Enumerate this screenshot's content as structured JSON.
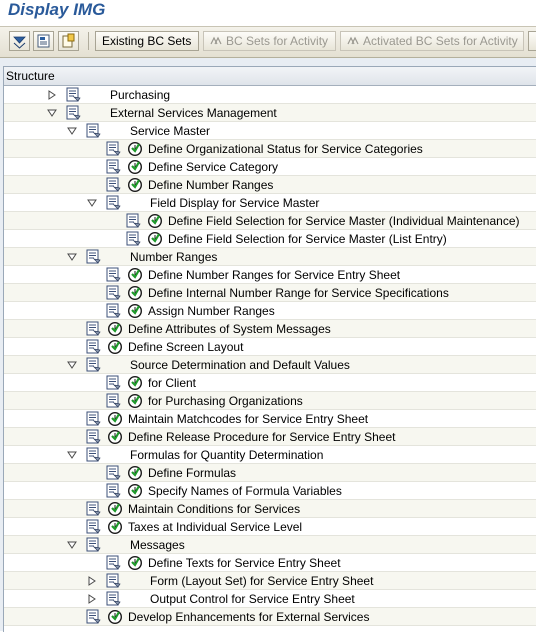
{
  "window": {
    "title": "Display IMG"
  },
  "toolbar": {
    "existing_bc_sets": "Existing BC Sets",
    "bc_sets_for_activity": "BC Sets for Activity",
    "activated_bc_sets_for_activity": "Activated BC Sets for Activity"
  },
  "tree": {
    "column_header": "Structure",
    "rows": [
      {
        "label": "Purchasing",
        "level": 0,
        "toggle": "collapsed",
        "activity": false
      },
      {
        "label": "External Services Management",
        "level": 0,
        "toggle": "expanded",
        "activity": false
      },
      {
        "label": "Service Master",
        "level": 1,
        "toggle": "expanded",
        "activity": false
      },
      {
        "label": "Define Organizational Status for Service Categories",
        "level": 2,
        "toggle": "none",
        "activity": true
      },
      {
        "label": "Define Service Category",
        "level": 2,
        "toggle": "none",
        "activity": true
      },
      {
        "label": "Define Number Ranges",
        "level": 2,
        "toggle": "none",
        "activity": true
      },
      {
        "label": "Field Display for Service Master",
        "level": 2,
        "toggle": "expanded",
        "activity": false
      },
      {
        "label": "Define Field Selection for Service Master (Individual Maintenance)",
        "level": 3,
        "toggle": "none",
        "activity": true
      },
      {
        "label": "Define Field Selection for Service Master (List Entry)",
        "level": 3,
        "toggle": "none",
        "activity": true
      },
      {
        "label": "Number Ranges",
        "level": 1,
        "toggle": "expanded",
        "activity": false
      },
      {
        "label": "Define Number Ranges for Service Entry Sheet",
        "level": 2,
        "toggle": "none",
        "activity": true
      },
      {
        "label": "Define Internal Number Range for Service Specifications",
        "level": 2,
        "toggle": "none",
        "activity": true
      },
      {
        "label": "Assign Number Ranges",
        "level": 2,
        "toggle": "none",
        "activity": true
      },
      {
        "label": "Define Attributes of System Messages",
        "level": 1,
        "toggle": "none",
        "activity": true
      },
      {
        "label": "Define Screen Layout",
        "level": 1,
        "toggle": "none",
        "activity": true
      },
      {
        "label": "Source Determination and Default Values",
        "level": 1,
        "toggle": "expanded",
        "activity": false
      },
      {
        "label": "for Client",
        "level": 2,
        "toggle": "none",
        "activity": true
      },
      {
        "label": "for Purchasing Organizations",
        "level": 2,
        "toggle": "none",
        "activity": true
      },
      {
        "label": "Maintain Matchcodes for Service Entry Sheet",
        "level": 1,
        "toggle": "none",
        "activity": true
      },
      {
        "label": "Define Release Procedure for Service Entry Sheet",
        "level": 1,
        "toggle": "none",
        "activity": true
      },
      {
        "label": "Formulas for Quantity Determination",
        "level": 1,
        "toggle": "expanded",
        "activity": false
      },
      {
        "label": "Define Formulas",
        "level": 2,
        "toggle": "none",
        "activity": true
      },
      {
        "label": "Specify Names of Formula Variables",
        "level": 2,
        "toggle": "none",
        "activity": true
      },
      {
        "label": "Maintain Conditions for Services",
        "level": 1,
        "toggle": "none",
        "activity": true
      },
      {
        "label": "Taxes at Individual Service Level",
        "level": 1,
        "toggle": "none",
        "activity": true
      },
      {
        "label": "Messages",
        "level": 1,
        "toggle": "expanded",
        "activity": false
      },
      {
        "label": "Define Texts for Service Entry Sheet",
        "level": 2,
        "toggle": "none",
        "activity": true
      },
      {
        "label": "Form (Layout Set) for Service Entry Sheet",
        "level": 2,
        "toggle": "collapsed",
        "activity": false
      },
      {
        "label": "Output Control for Service Entry Sheet",
        "level": 2,
        "toggle": "collapsed",
        "activity": false
      },
      {
        "label": "Develop Enhancements for External Services",
        "level": 1,
        "toggle": "none",
        "activity": true
      }
    ]
  }
}
